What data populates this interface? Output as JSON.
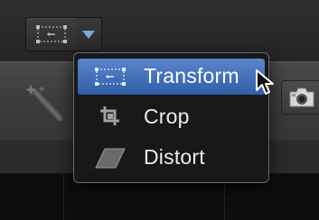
{
  "toolbar": {
    "mode_button_icon": "transform-icon",
    "dropdown_icon": "chevron-down-icon",
    "wand_icon": "magic-wand-icon",
    "camera_icon": "camera-icon"
  },
  "menu": {
    "items": [
      {
        "label": "Transform",
        "icon": "transform-icon",
        "selected": true
      },
      {
        "label": "Crop",
        "icon": "crop-icon",
        "selected": false
      },
      {
        "label": "Distort",
        "icon": "distort-icon",
        "selected": false
      }
    ]
  },
  "colors": {
    "selection": "#3a6cb8",
    "menu_background": "#181818",
    "dropdown_arrow": "#7aa6d8"
  }
}
